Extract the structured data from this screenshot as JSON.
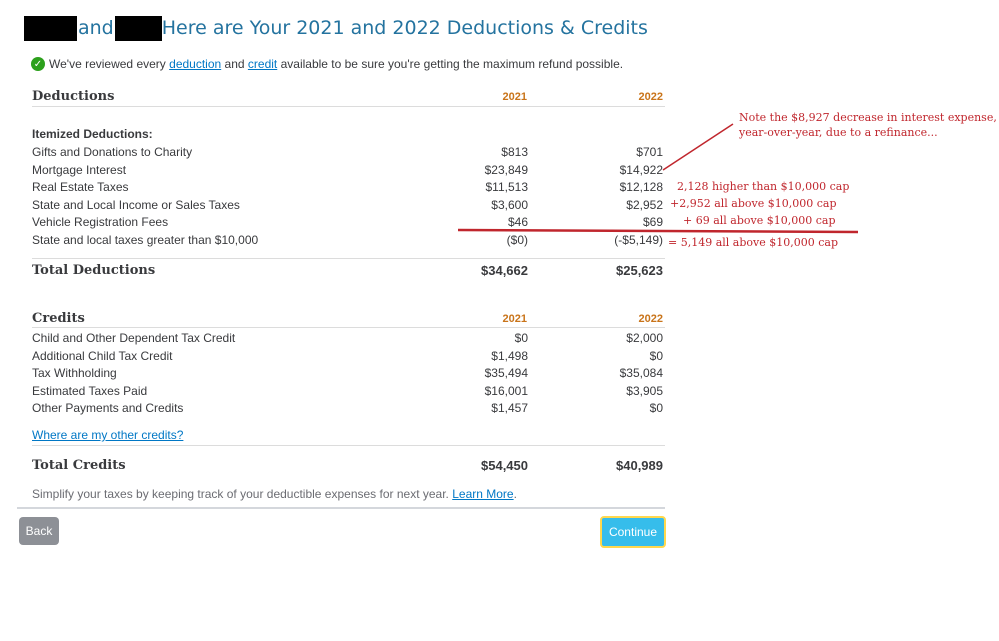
{
  "header": {
    "and_word": "and",
    "title": "Here are Your 2021 and 2022 Deductions & Credits"
  },
  "intro": {
    "prefix": "We've reviewed every",
    "deduction_link": "deduction",
    "and": "and",
    "credit_link": "credit",
    "suffix": "available to be sure you're getting the maximum refund possible."
  },
  "deductions": {
    "heading": "Deductions",
    "year1": "2021",
    "year2": "2022",
    "subheading": "Itemized Deductions:",
    "rows": [
      {
        "label": "Gifts and Donations to Charity",
        "v2021": "$813",
        "v2022": "$701"
      },
      {
        "label": "Mortgage Interest",
        "v2021": "$23,849",
        "v2022": "$14,922"
      },
      {
        "label": "Real Estate Taxes",
        "v2021": "$11,513",
        "v2022": "$12,128"
      },
      {
        "label": "State and Local Income or Sales Taxes",
        "v2021": "$3,600",
        "v2022": "$2,952"
      },
      {
        "label": "Vehicle Registration Fees",
        "v2021": "$46",
        "v2022": "$69"
      },
      {
        "label": "State and local taxes greater than $10,000",
        "v2021": "($0)",
        "v2022": "(-$5,149)"
      }
    ],
    "total_label": "Total Deductions",
    "total_2021": "$34,662",
    "total_2022": "$25,623"
  },
  "credits": {
    "heading": "Credits",
    "year1": "2021",
    "year2": "2022",
    "rows": [
      {
        "label": "Child and Other Dependent Tax Credit",
        "v2021": "$0",
        "v2022": "$2,000"
      },
      {
        "label": "Additional Child Tax Credit",
        "v2021": "$1,498",
        "v2022": "$0"
      },
      {
        "label": "Tax Withholding",
        "v2021": "$35,494",
        "v2022": "$35,084"
      },
      {
        "label": "Estimated Taxes Paid",
        "v2021": "$16,001",
        "v2022": "$3,905"
      },
      {
        "label": "Other Payments and Credits",
        "v2021": "$1,457",
        "v2022": "$0"
      }
    ],
    "other_link": "Where are my other credits?",
    "total_label": "Total Credits",
    "total_2021": "$54,450",
    "total_2022": "$40,989"
  },
  "footer": {
    "tip": "Simplify your taxes by keeping track of your deductible expenses for next year.",
    "learn_more": "Learn More",
    "period": "."
  },
  "buttons": {
    "back": "Back",
    "continue": "Continue"
  },
  "annotations": {
    "note_line1": "Note the $8,927 decrease in interest expense,",
    "note_line2": "year-over-year, due to a refinance...",
    "real_estate": "2,128 higher than $10,000 cap",
    "state_local": "+2,952 all above $10,000 cap",
    "vehicle": "+ 69 all above $10,000  cap",
    "total_excess": "= 5,149 all above $10,000 cap"
  },
  "colors": {
    "title": "#24739f",
    "year": "#c9741a",
    "annotation": "#c0262d",
    "link": "#0077c5",
    "continue": "#36bdeb"
  }
}
